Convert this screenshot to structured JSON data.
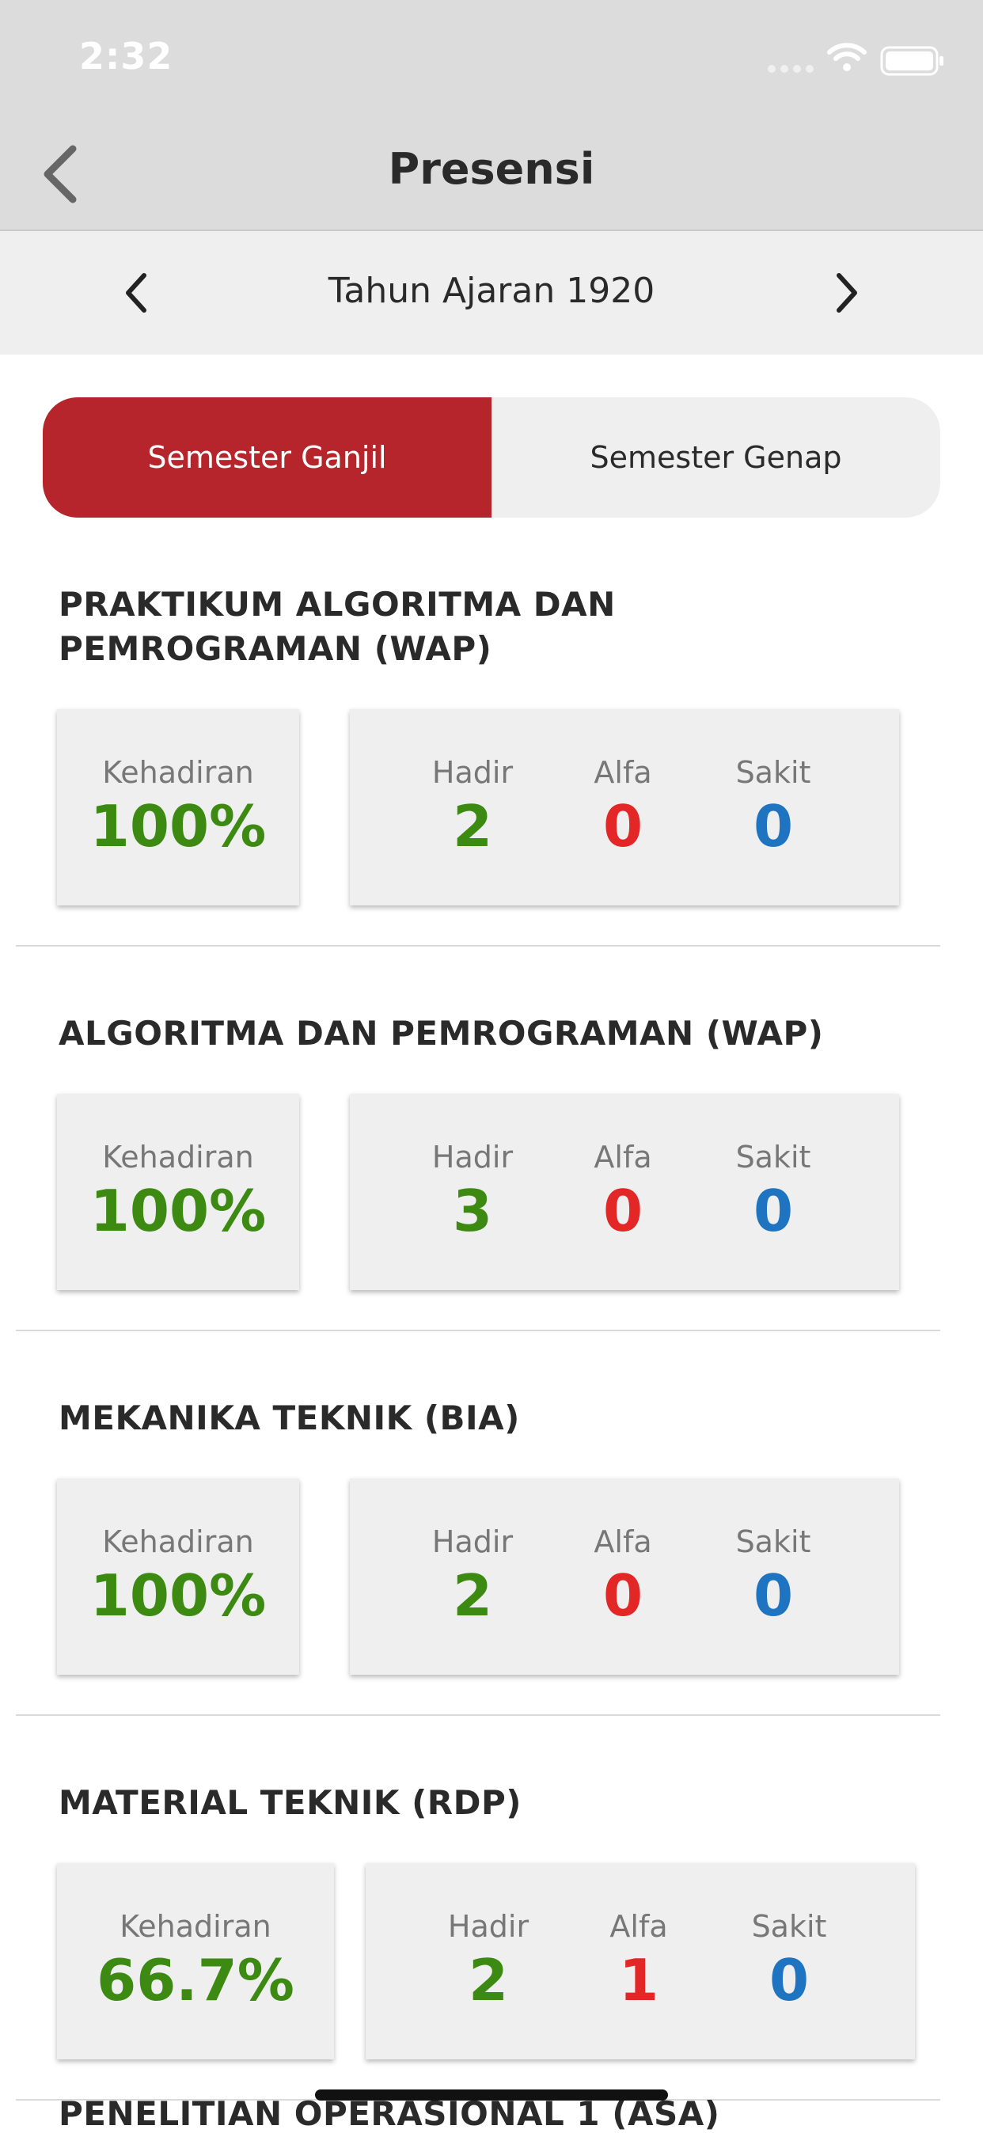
{
  "status_bar": {
    "time": "2:32"
  },
  "header": {
    "title": "Presensi"
  },
  "year_selector": {
    "label": "Tahun Ajaran 1920"
  },
  "semester_tabs": [
    {
      "label": "Semester Ganjil",
      "active": true
    },
    {
      "label": "Semester Genap",
      "active": false
    }
  ],
  "labels": {
    "attendance": "Kehadiran",
    "present": "Hadir",
    "absent": "Alfa",
    "sick": "Sakit"
  },
  "courses": [
    {
      "title": "PRAKTIKUM ALGORITMA DAN PEMROGRAMAN (WAP)",
      "attendance": "100%",
      "present": "2",
      "absent": "0",
      "sick": "0"
    },
    {
      "title": "ALGORITMA DAN PEMROGRAMAN (WAP)",
      "attendance": "100%",
      "present": "3",
      "absent": "0",
      "sick": "0"
    },
    {
      "title": "MEKANIKA TEKNIK (BIA)",
      "attendance": "100%",
      "present": "2",
      "absent": "0",
      "sick": "0"
    },
    {
      "title": "MATERIAL TEKNIK (RDP)",
      "attendance": "66.7%",
      "present": "2",
      "absent": "1",
      "sick": "0"
    }
  ],
  "next_course_title": "PENELITIAN OPERASIONAL 1 (ASA)",
  "colors": {
    "accent": "#b5252b",
    "present": "#3d8a12",
    "absent": "#e32626",
    "sick": "#1f74c2"
  }
}
